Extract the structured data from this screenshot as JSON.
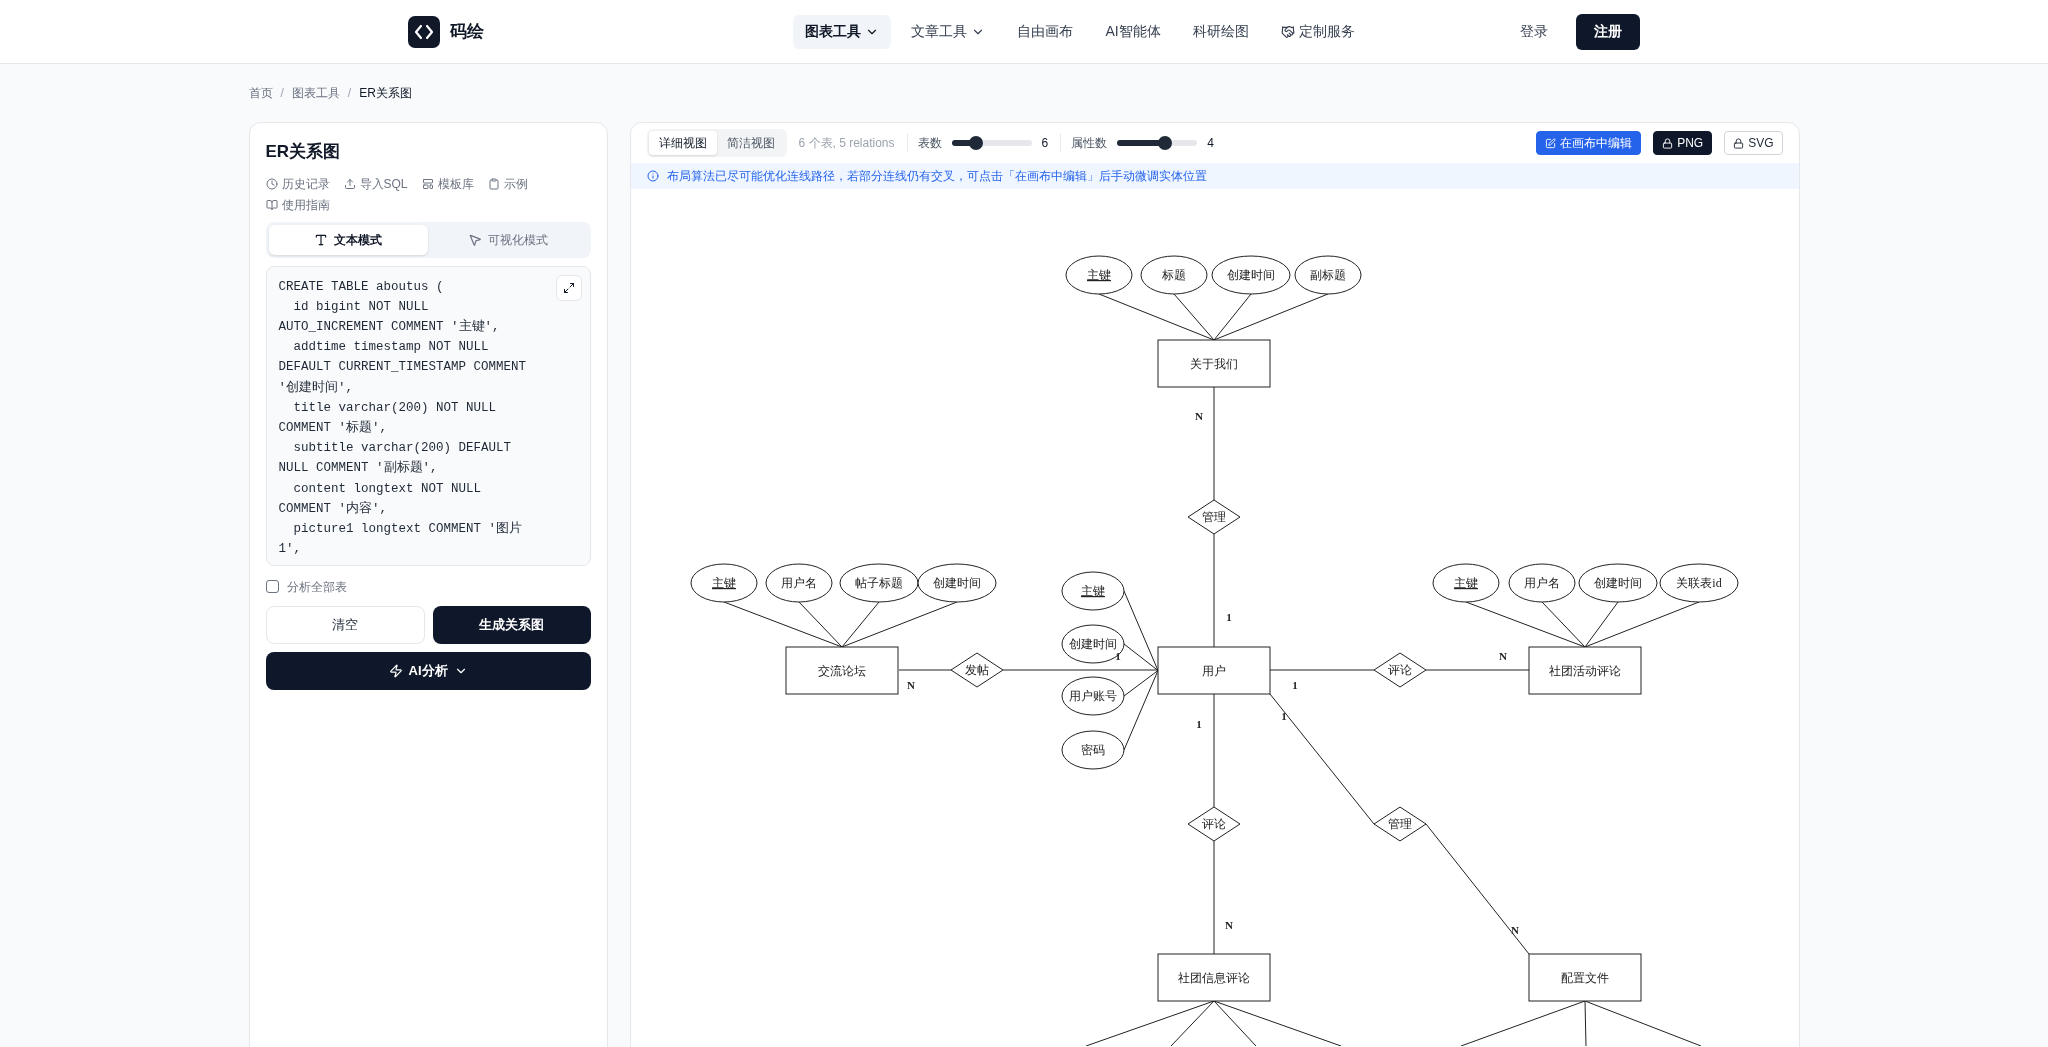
{
  "header": {
    "brand": "码绘",
    "nav": [
      {
        "label": "图表工具",
        "selected": true,
        "has_menu": true,
        "kind": "text"
      },
      {
        "label": "文章工具",
        "selected": false,
        "has_menu": true,
        "kind": "text"
      },
      {
        "label": "自由画布",
        "selected": false,
        "has_menu": false,
        "kind": "text"
      },
      {
        "label": "AI智能体",
        "selected": false,
        "has_menu": false,
        "kind": "text"
      },
      {
        "label": "科研绘图",
        "selected": false,
        "has_menu": false,
        "kind": "text"
      },
      {
        "label": "定制服务",
        "selected": false,
        "has_menu": false,
        "kind": "icon"
      }
    ],
    "login": "登录",
    "register": "注册"
  },
  "breadcrumb": {
    "separator": "/",
    "items": [
      "首页",
      "图表工具",
      "ER关系图"
    ]
  },
  "sidebar": {
    "title": "ER关系图",
    "links": [
      "历史记录",
      "导入SQL",
      "模板库",
      "示例",
      "使用指南"
    ],
    "modes": [
      {
        "label": "文本模式",
        "selected": true
      },
      {
        "label": "可视化模式",
        "selected": false
      }
    ],
    "code": "CREATE TABLE aboutus (\n  id bigint NOT NULL AUTO_INCREMENT COMMENT '主键',\n  addtime timestamp NOT NULL DEFAULT CURRENT_TIMESTAMP COMMENT '创建时间',\n  title varchar(200) NOT NULL COMMENT '标题',\n  subtitle varchar(200) DEFAULT NULL COMMENT '副标题',\n  content longtext NOT NULL COMMENT '内容',\n  picture1 longtext COMMENT '图片1',",
    "analyze_all": {
      "label": "分析全部表",
      "checked": false
    },
    "clear_button": "清空",
    "generate_button": "生成关系图",
    "ai_button": "AI分析"
  },
  "canvas": {
    "views": [
      {
        "label": "详细视图",
        "selected": true
      },
      {
        "label": "简洁视图",
        "selected": false
      }
    ],
    "summary": "6 个表, 5 relations",
    "sliders": [
      {
        "label": "表数",
        "level": 0.3,
        "reading": "6"
      },
      {
        "label": "属性数",
        "level": 0.6,
        "reading": "4"
      }
    ],
    "actions": [
      {
        "label": "在画布中编辑",
        "kind": "primary"
      },
      {
        "label": "PNG",
        "kind": "dark"
      },
      {
        "label": "SVG",
        "kind": "outline"
      }
    ],
    "info": "布局算法已尽可能优化连线路径，若部分连线仍有交叉，可点击「在画布中编辑」后手动微调实体位置",
    "diagram": {
      "entities": [
        {
          "name": "关于我们",
          "attributes": [
            {
              "label": "主键",
              "primary_key": true
            },
            {
              "label": "标题",
              "primary_key": false
            },
            {
              "label": "创建时间",
              "primary_key": false
            },
            {
              "label": "副标题",
              "primary_key": false
            }
          ]
        },
        {
          "name": "交流论坛",
          "attributes": [
            {
              "label": "主键",
              "primary_key": true
            },
            {
              "label": "用户名",
              "primary_key": false
            },
            {
              "label": "帖子标题",
              "primary_key": false
            },
            {
              "label": "创建时间",
              "primary_key": false
            }
          ]
        },
        {
          "name": "用户",
          "attributes": [
            {
              "label": "主键",
              "primary_key": true
            },
            {
              "label": "创建时间",
              "primary_key": false
            },
            {
              "label": "用户账号",
              "primary_key": false
            },
            {
              "label": "密码",
              "primary_key": false
            }
          ]
        },
        {
          "name": "社团活动评论",
          "attributes": [
            {
              "label": "主键",
              "primary_key": true
            },
            {
              "label": "用户名",
              "primary_key": false
            },
            {
              "label": "创建时间",
              "primary_key": false
            },
            {
              "label": "关联表id",
              "primary_key": false
            }
          ]
        },
        {
          "name": "社团信息评论"
        },
        {
          "name": "配置文件"
        }
      ],
      "relationships": [
        {
          "name": "管理",
          "card_a": "N",
          "card_b": "1"
        },
        {
          "name": "发帖",
          "card_a": "N",
          "card_b": "1"
        },
        {
          "name": "评论",
          "card_a": "1",
          "card_b": "N"
        },
        {
          "name": "评论",
          "card_a": "1",
          "card_b": "N"
        },
        {
          "name": "管理",
          "card_a": "1",
          "card_b": "N"
        }
      ]
    }
  }
}
